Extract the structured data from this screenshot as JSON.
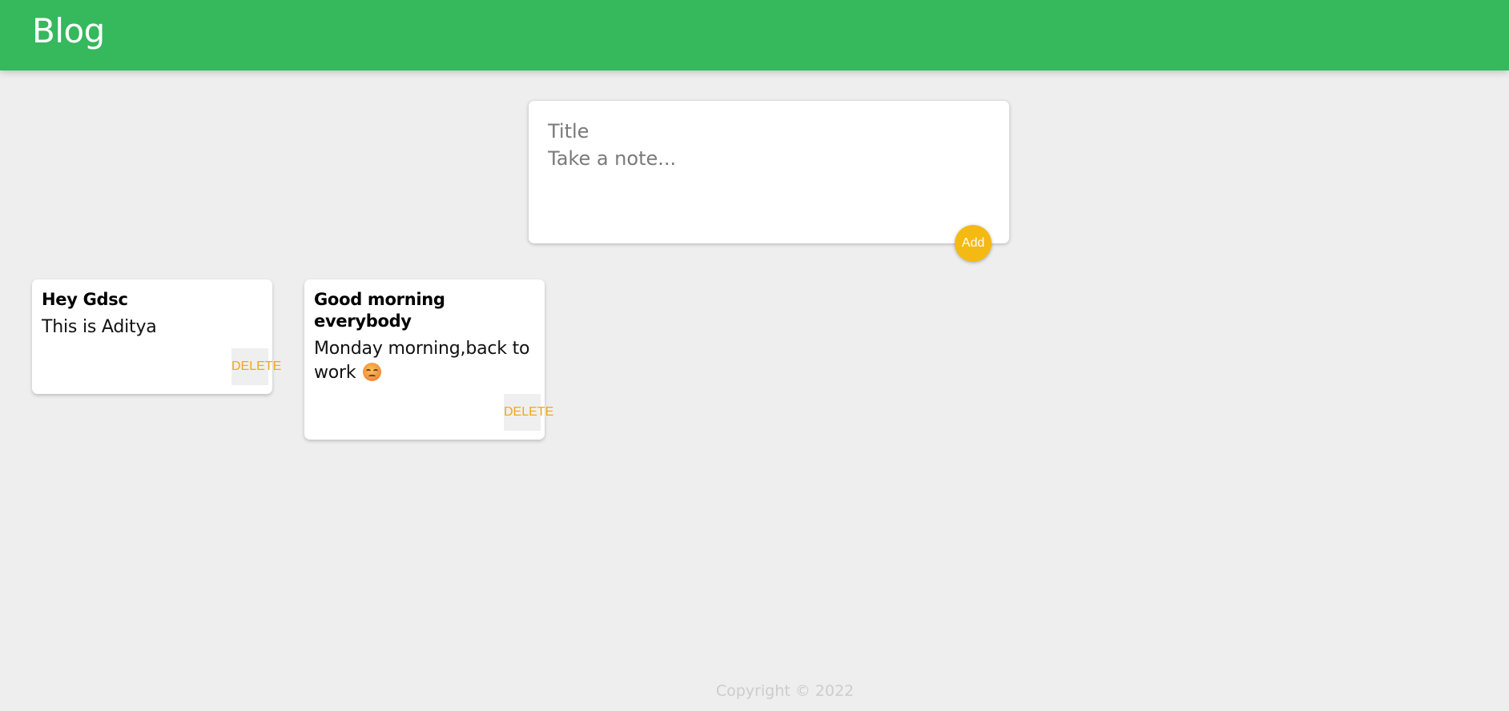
{
  "header": {
    "title": "Blog"
  },
  "composer": {
    "title_placeholder": "Title",
    "content_placeholder": "Take a note...",
    "add_label": "Add"
  },
  "notes": [
    {
      "title": "Hey Gdsc",
      "content": "This is Aditya",
      "delete_label": "DELETE"
    },
    {
      "title": "Good morning everybody",
      "content": "Monday morning,back to work",
      "emoji": "weary-face-icon",
      "delete_label": "DELETE"
    }
  ],
  "footer": {
    "copyright": "Copyright © 2022"
  },
  "colors": {
    "header_bg": "#36b85c",
    "page_bg": "#eeeeee",
    "accent": "#f5b914",
    "delete_text": "#f5a70f"
  }
}
